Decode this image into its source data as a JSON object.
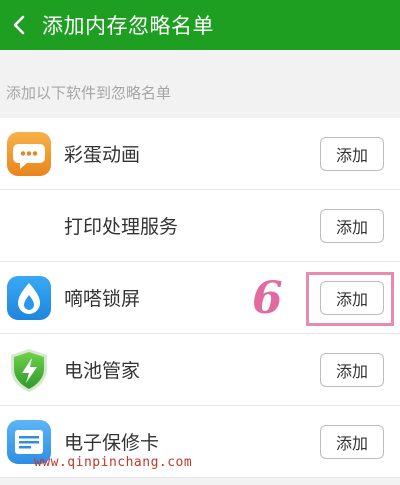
{
  "header": {
    "title": "添加内存忽略名单",
    "bg_color": "#1e9f22"
  },
  "section": {
    "label": "添加以下软件到忽略名单"
  },
  "apps": [
    {
      "name": "彩蛋动画",
      "icon": "chat-bubble-icon",
      "button": "添加"
    },
    {
      "name": "打印处理服务",
      "icon": "",
      "button": "添加"
    },
    {
      "name": "嘀嗒锁屏",
      "icon": "flame-drop-icon",
      "button": "添加"
    },
    {
      "name": "电池管家",
      "icon": "shield-bolt-icon",
      "button": "添加"
    },
    {
      "name": "电子保修卡",
      "icon": "card-icon",
      "button": "添加"
    }
  ],
  "annotation": {
    "step_number": "6",
    "highlight_color": "#e58cb0"
  },
  "watermark": "www.qinpinchang.com"
}
